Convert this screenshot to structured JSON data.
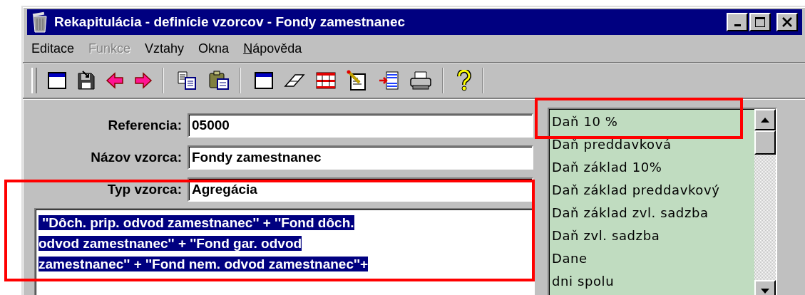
{
  "window": {
    "title": "Rekapitulácia - definície vzorcov - Fondy zamestnanec"
  },
  "menu": [
    {
      "label": "Editace",
      "disabled": false,
      "mnemonic": false
    },
    {
      "label": "Funkce",
      "disabled": true,
      "mnemonic": false
    },
    {
      "label": "Vztahy",
      "disabled": false,
      "mnemonic": false
    },
    {
      "label": "Okna",
      "disabled": false,
      "mnemonic": false
    },
    {
      "label": "Nápověda",
      "disabled": false,
      "mnemonic": true
    }
  ],
  "fields": [
    {
      "label": "Referencia:",
      "value": "05000"
    },
    {
      "label": "Názov vzorca:",
      "value": "Fondy zamestnanec"
    },
    {
      "label": "Typ vzorca:",
      "value": "Agregácia"
    }
  ],
  "formula": {
    "selected": true,
    "lines": [
      " ''Dôch. prip. odvod zamestnanec'' + ''Fond dôch.",
      "odvod zamestnanec'' + ''Fond gar. odvod",
      "zamestnanec'' + ''Fond nem. odvod zamestnanec''+"
    ]
  },
  "list": [
    "Daň 10 %",
    "Daň preddavková",
    "Daň základ 10%",
    "Daň základ preddavkový",
    "Daň základ zvl. sadzba",
    "Daň zvl. sadzba",
    "Dane",
    "dni spolu"
  ]
}
